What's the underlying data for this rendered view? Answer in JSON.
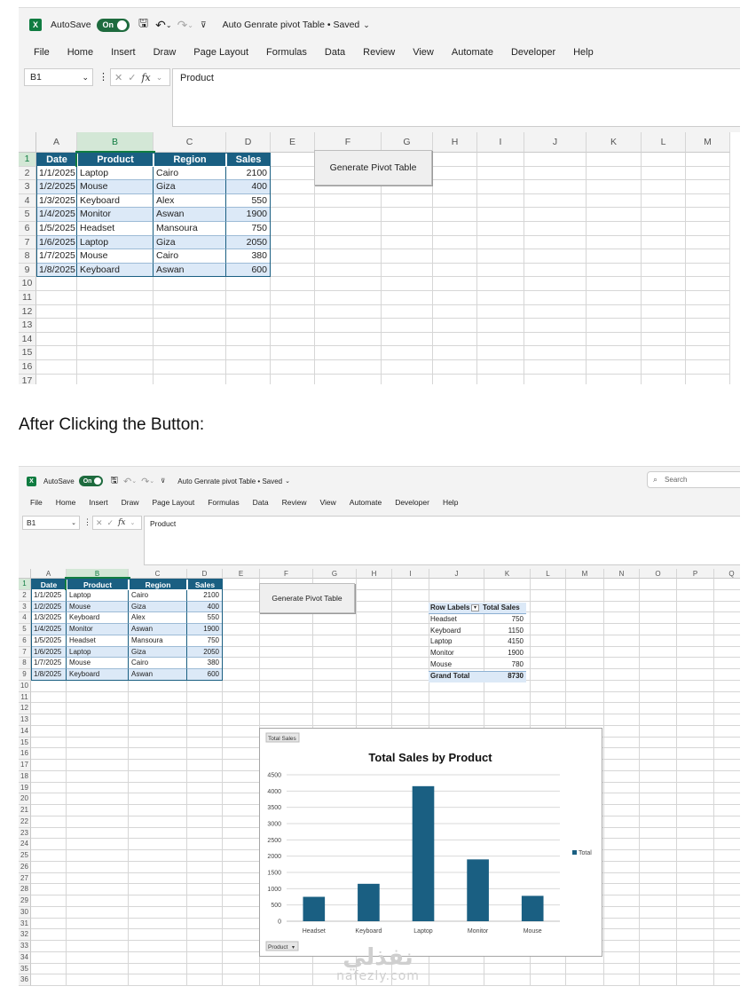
{
  "app": {
    "autosave_label": "AutoSave",
    "toggle_label": "On",
    "doc_title": "Auto Genrate pivot Table • Saved",
    "search_placeholder": "Search"
  },
  "ribbon_tabs": [
    "File",
    "Home",
    "Insert",
    "Draw",
    "Page Layout",
    "Formulas",
    "Data",
    "Review",
    "View",
    "Automate",
    "Developer",
    "Help"
  ],
  "formula": {
    "cell_ref": "B1",
    "cancel": "✕",
    "enter": "✓",
    "fx": "fx",
    "value": "Product"
  },
  "columns1": [
    "A",
    "B",
    "C",
    "D",
    "E",
    "F",
    "G",
    "H",
    "I",
    "J",
    "K",
    "L",
    "M"
  ],
  "columns2": [
    "A",
    "B",
    "C",
    "D",
    "E",
    "F",
    "G",
    "H",
    "I",
    "J",
    "K",
    "L",
    "M",
    "N",
    "O",
    "P",
    "Q"
  ],
  "table": {
    "headers": [
      "Date",
      "Product",
      "Region",
      "Sales"
    ],
    "rows": [
      [
        "1/1/2025",
        "Laptop",
        "Cairo",
        "2100"
      ],
      [
        "1/2/2025",
        "Mouse",
        "Giza",
        "400"
      ],
      [
        "1/3/2025",
        "Keyboard",
        "Alex",
        "550"
      ],
      [
        "1/4/2025",
        "Monitor",
        "Aswan",
        "1900"
      ],
      [
        "1/5/2025",
        "Headset",
        "Mansoura",
        "750"
      ],
      [
        "1/6/2025",
        "Laptop",
        "Giza",
        "2050"
      ],
      [
        "1/7/2025",
        "Mouse",
        "Cairo",
        "380"
      ],
      [
        "1/8/2025",
        "Keyboard",
        "Aswan",
        "600"
      ]
    ]
  },
  "button_label": "Generate Pivot Table",
  "caption": "After Clicking the Button:",
  "pivot": {
    "row_labels": "Row Labels",
    "total_sales": "Total Sales",
    "rows": [
      [
        "Headset",
        "750"
      ],
      [
        "Keyboard",
        "1150"
      ],
      [
        "Laptop",
        "4150"
      ],
      [
        "Monitor",
        "1900"
      ],
      [
        "Mouse",
        "780"
      ]
    ],
    "grand_total_label": "Grand Total",
    "grand_total_value": "8730"
  },
  "chart_data": {
    "type": "bar",
    "title": "Total Sales by Product",
    "field_button": "Total Sales",
    "axis_field_button": "Product",
    "categories": [
      "Headset",
      "Keyboard",
      "Laptop",
      "Monitor",
      "Mouse"
    ],
    "series": [
      {
        "name": "Total",
        "values": [
          750,
          1150,
          4150,
          1900,
          780
        ]
      }
    ],
    "ylim": [
      0,
      4500
    ],
    "yticks": [
      0,
      500,
      1000,
      1500,
      2000,
      2500,
      3000,
      3500,
      4000,
      4500
    ],
    "legend": "right",
    "grid": true,
    "bar_color": "#1a5f82"
  },
  "watermark": {
    "arabic": "نفذلي",
    "latin": "nafezly.com"
  },
  "colors": {
    "header": "#1a5f82",
    "band": "#dce9f7",
    "excel_green": "#107c41"
  }
}
